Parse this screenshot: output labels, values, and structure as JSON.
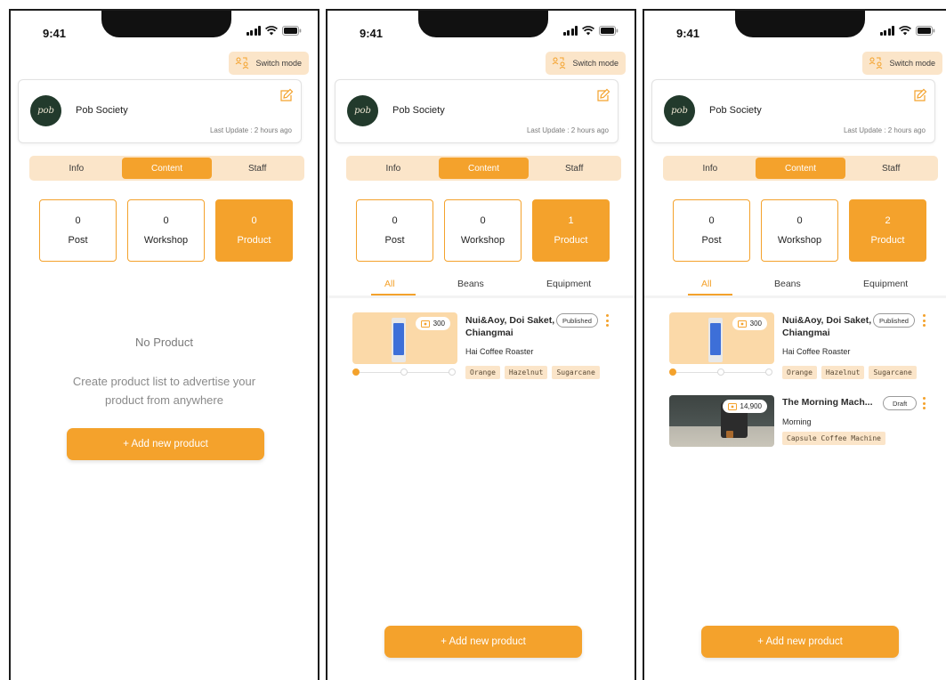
{
  "status": {
    "time": "9:41"
  },
  "switch_mode": "Switch mode",
  "shop": {
    "name": "Pob Society",
    "logo_text": "pob",
    "last_update": "Last Update : 2 hours ago"
  },
  "tabs": [
    "Info",
    "Content",
    "Staff"
  ],
  "stat_labels": [
    "Post",
    "Workshop",
    "Product"
  ],
  "filters": [
    "All",
    "Beans",
    "Equipment"
  ],
  "add_button": "+ Add new product",
  "empty": {
    "title": "No Product",
    "description": "Create product list to advertise your product from anywhere"
  },
  "colors": {
    "accent": "#f4a22c",
    "accent_light": "#fbe5c9"
  },
  "screens": [
    {
      "stats": [
        "0",
        "0",
        "0"
      ]
    },
    {
      "stats": [
        "0",
        "0",
        "1"
      ]
    },
    {
      "stats": [
        "0",
        "0",
        "2"
      ]
    }
  ],
  "products": [
    {
      "title_line1": "Nui&Aoy, Doi Saket,",
      "title_line2": "Chiangmai",
      "shop": "Hai Coffee Roaster",
      "price": "300",
      "status": "Published",
      "tags": [
        "Orange",
        "Hazelnut",
        "Sugarcane"
      ],
      "image_count": 3,
      "active_image": 1
    },
    {
      "title": "The Morning Mach...",
      "shop": "Morning",
      "price": "14,900",
      "status": "Draft",
      "tags": [
        "Capsule Coffee Machine"
      ]
    }
  ]
}
